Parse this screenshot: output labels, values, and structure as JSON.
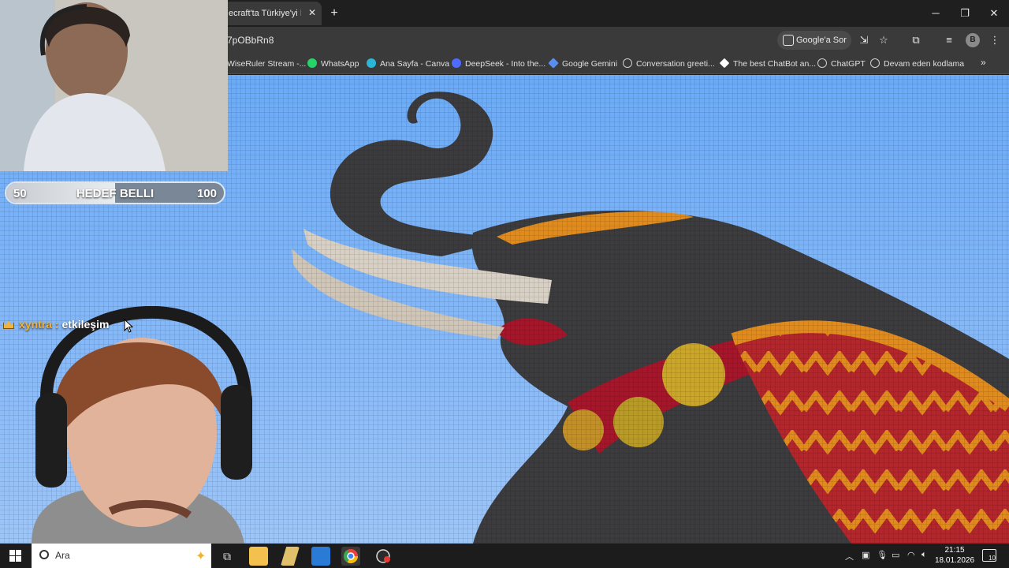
{
  "browser": {
    "tab_title": "ecraft'ta Türkiye'yi İnş",
    "tab_close": "✕",
    "new_tab": "+",
    "url": "7pOBbRn8",
    "ask_google": "Google'a Sor",
    "profile_initial": "B",
    "window_minimize": "─",
    "window_restore": "❐",
    "window_close": "✕",
    "bookmarks": [
      {
        "label": "WiseRuler Stream -..."
      },
      {
        "label": "WhatsApp",
        "color": "#25d366"
      },
      {
        "label": "Ana Sayfa - Canva",
        "color": "#2bb6d6"
      },
      {
        "label": "DeepSeek - Into the...",
        "color": "#4d6bfe"
      },
      {
        "label": "Google Gemini",
        "color": "#5b8def"
      },
      {
        "label": "Conversation greeti...",
        "color": "#cfcfcf"
      },
      {
        "label": "The best ChatBot an...",
        "color": "#ffffff"
      },
      {
        "label": "ChatGPT",
        "color": "#cfcfcf"
      },
      {
        "label": "Devam eden kodlama",
        "color": "#cfcfcf"
      }
    ],
    "bookmarks_more": "»"
  },
  "overlay": {
    "goal_start": "50",
    "goal_label": "HEDEF BELLI",
    "goal_end": "100",
    "goal_progress": 0.5,
    "chat_user": "xyntra",
    "chat_sep": " : ",
    "chat_message": "etkileşim"
  },
  "taskbar": {
    "search_placeholder": "Ara",
    "time": "21:15",
    "date": "18.01.2026",
    "notification_count": "10"
  },
  "colors": {
    "sky": "#7ab4f8",
    "elephant": "#3c3c3e",
    "tusk": "#d8d0c4",
    "cloth_red": "#b3262c",
    "cloth_orange": "#e08b1e"
  }
}
